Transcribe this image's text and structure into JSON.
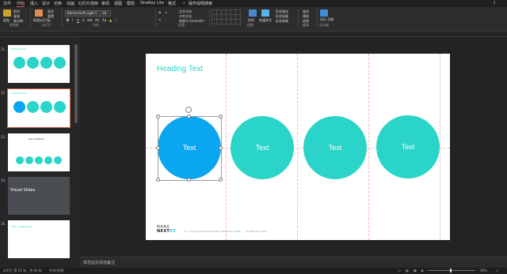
{
  "tabs": [
    "文件",
    "开始",
    "插入",
    "设计",
    "切换",
    "动画",
    "幻灯片放映",
    "审阅",
    "视图",
    "帮助",
    "OneKey Lite",
    "格式"
  ],
  "search_label": "操作说明搜索",
  "ribbon": {
    "clipboard_items": [
      "剪切",
      "复制",
      "格式刷"
    ],
    "paste_label": "粘贴",
    "new_slide": "新建幻灯片",
    "layout": "版式",
    "reset": "重置",
    "section": "节",
    "font_name": "Bahnschrift Light C",
    "font_size": "18",
    "font_buttons": [
      "B",
      "I",
      "U",
      "S",
      "abc",
      "AV",
      "Aa"
    ],
    "text_direction": "文字方向",
    "align_text": "对齐文本",
    "smartart": "转换为 SmartArt",
    "arrange": "排列",
    "quick_styles": "快速样式",
    "shape_fill": "形状填充",
    "shape_outline": "形状轮廓",
    "shape_effects": "形状效果",
    "find": "查找",
    "replace": "替换",
    "select": "选择",
    "design_ideas": "设计\n灵感",
    "groups": [
      "剪贴板",
      "幻灯片",
      "字体",
      "段落",
      "绘图",
      "编辑",
      "设计器"
    ]
  },
  "thumbnails": [
    {
      "num": "11",
      "circles": [
        "#2bd4c9",
        "#2bd4c9",
        "#2bd4c9",
        "#2bd4c9"
      ],
      "text": "Heading Text"
    },
    {
      "num": "12",
      "circles": [
        "#0aa6ef",
        "#2bd4c9",
        "#2bd4c9",
        "#2bd4c9"
      ],
      "text": "Heading Text",
      "selected": true
    },
    {
      "num": "13",
      "text": "Key Headline",
      "circles": [
        "#2bd4c9",
        "#2bd4c9",
        "#2bd4c9",
        "#2bd4c9",
        "#2bd4c9"
      ]
    },
    {
      "num": "14",
      "text": "Visual Slides",
      "dark": true
    },
    {
      "num": "15",
      "text": "Main content text"
    }
  ],
  "slide": {
    "heading": "Heading Text",
    "circles": [
      {
        "label": "Text",
        "color": "#0aa6ef"
      },
      {
        "label": "Text",
        "color": "#2bd4c9"
      },
      {
        "label": "Text",
        "color": "#2bd4c9"
      },
      {
        "label": "Text",
        "color": "#2bd4c9"
      }
    ],
    "logo_cn": "新未来志",
    "logo_main": "NEXT",
    "logo_accent": "EV",
    "footer_text": "12 + V.2 Upgrade Presentation Template 1.888 )",
    "footer_date": "28 February 2022"
  },
  "notes_placeholder": "单击此处添加备注",
  "status": {
    "slide_info": "幻灯片 第 12 张，共 40 张",
    "language": "中文(中国)",
    "zoom": "58%"
  },
  "colors": {
    "accent": "#2bd4c9",
    "selected_circle": "#0aa6ef",
    "tab_active": "#d24a4a"
  }
}
